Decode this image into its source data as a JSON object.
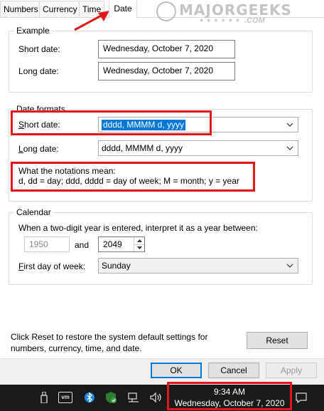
{
  "tabs": {
    "numbers": "Numbers",
    "currency": "Currency",
    "time": "Time",
    "date": "Date"
  },
  "watermark": {
    "line1": "MAJORGEEKS",
    "line2": ".COM"
  },
  "example": {
    "legend": "Example",
    "short_label": "Short date:",
    "short_value": "Wednesday, October 7, 2020",
    "long_label": "Long date:",
    "long_value": "Wednesday, October 7, 2020"
  },
  "formats": {
    "legend": "Date formats",
    "short_label": "Short date:",
    "short_value": "dddd, MMMM d, yyyy",
    "long_label": "Long date:",
    "long_value": "dddd, MMMM d, yyyy",
    "notation_title": "What the notations mean:",
    "notation_text": "d, dd = day;  ddd, dddd = day of week;  M = month;  y = year"
  },
  "calendar": {
    "legend": "Calendar",
    "two_digit_text": "When a two-digit year is entered, interpret it as a year between:",
    "year_from": "1950",
    "and_label": "and",
    "year_to": "2049",
    "first_day_label": "First day of week:",
    "first_day_value": "Sunday"
  },
  "reset": {
    "text_line1": "Click Reset to restore the system default settings for",
    "text_line2": "numbers, currency, time, and date.",
    "button": "Reset"
  },
  "buttons": {
    "ok": "OK",
    "cancel": "Cancel",
    "apply": "Apply"
  },
  "taskbar": {
    "time": "9:34 AM",
    "date": "Wednesday, October 7, 2020",
    "vm_icon_text": "vm"
  },
  "colors": {
    "highlight_red": "#e0181b",
    "selection_blue": "#0078d7",
    "taskbar": "#1a1a1a"
  }
}
